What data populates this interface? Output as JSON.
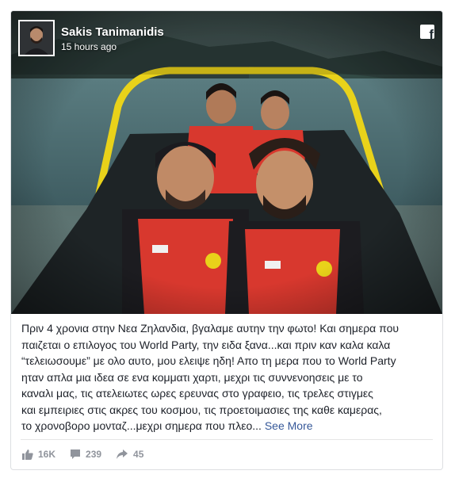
{
  "post": {
    "author": "Sakis Tanimanidis",
    "timestamp": "15 hours ago",
    "platform_icon": "facebook-icon",
    "text_lines": [
      "Πριν 4 χρονια στην Νεα Ζηλανδια, βγαλαμε αυτην την φωτο! Και σημερα που",
      "παιζεται ο επιλογος του World Party, την ειδα ξανα...και πριν καν καλα καλα",
      "“τελειωσουμε” με ολο αυτο, μου ελειψε ηδη! Απο τη μερα που το World Party",
      "ηταν απλα μια ιδεα σε ενα κομματι χαρτι, μεχρι τις συννενοησεις με το",
      "καναλι μας, τις ατελειωτες ωρες ερευνας στο γραφειο, τις τρελες στιγμες",
      "και εμπειριες στις ακρες του κοσμου, τις προετοιμασιες της καθε καμερας,",
      "το χρονοβορο μονταζ...μεχρι σημερα που πλεο..."
    ],
    "see_more": "See More"
  },
  "stats": {
    "likes": "16K",
    "comments": "239",
    "shares": "45"
  },
  "colors": {
    "link": "#365899",
    "text": "#1d2129",
    "muted": "#90949c",
    "vest": "#d8382e",
    "boat": "#e9d21a"
  },
  "icons": [
    "facebook-icon",
    "like-icon",
    "comment-icon",
    "share-icon"
  ]
}
